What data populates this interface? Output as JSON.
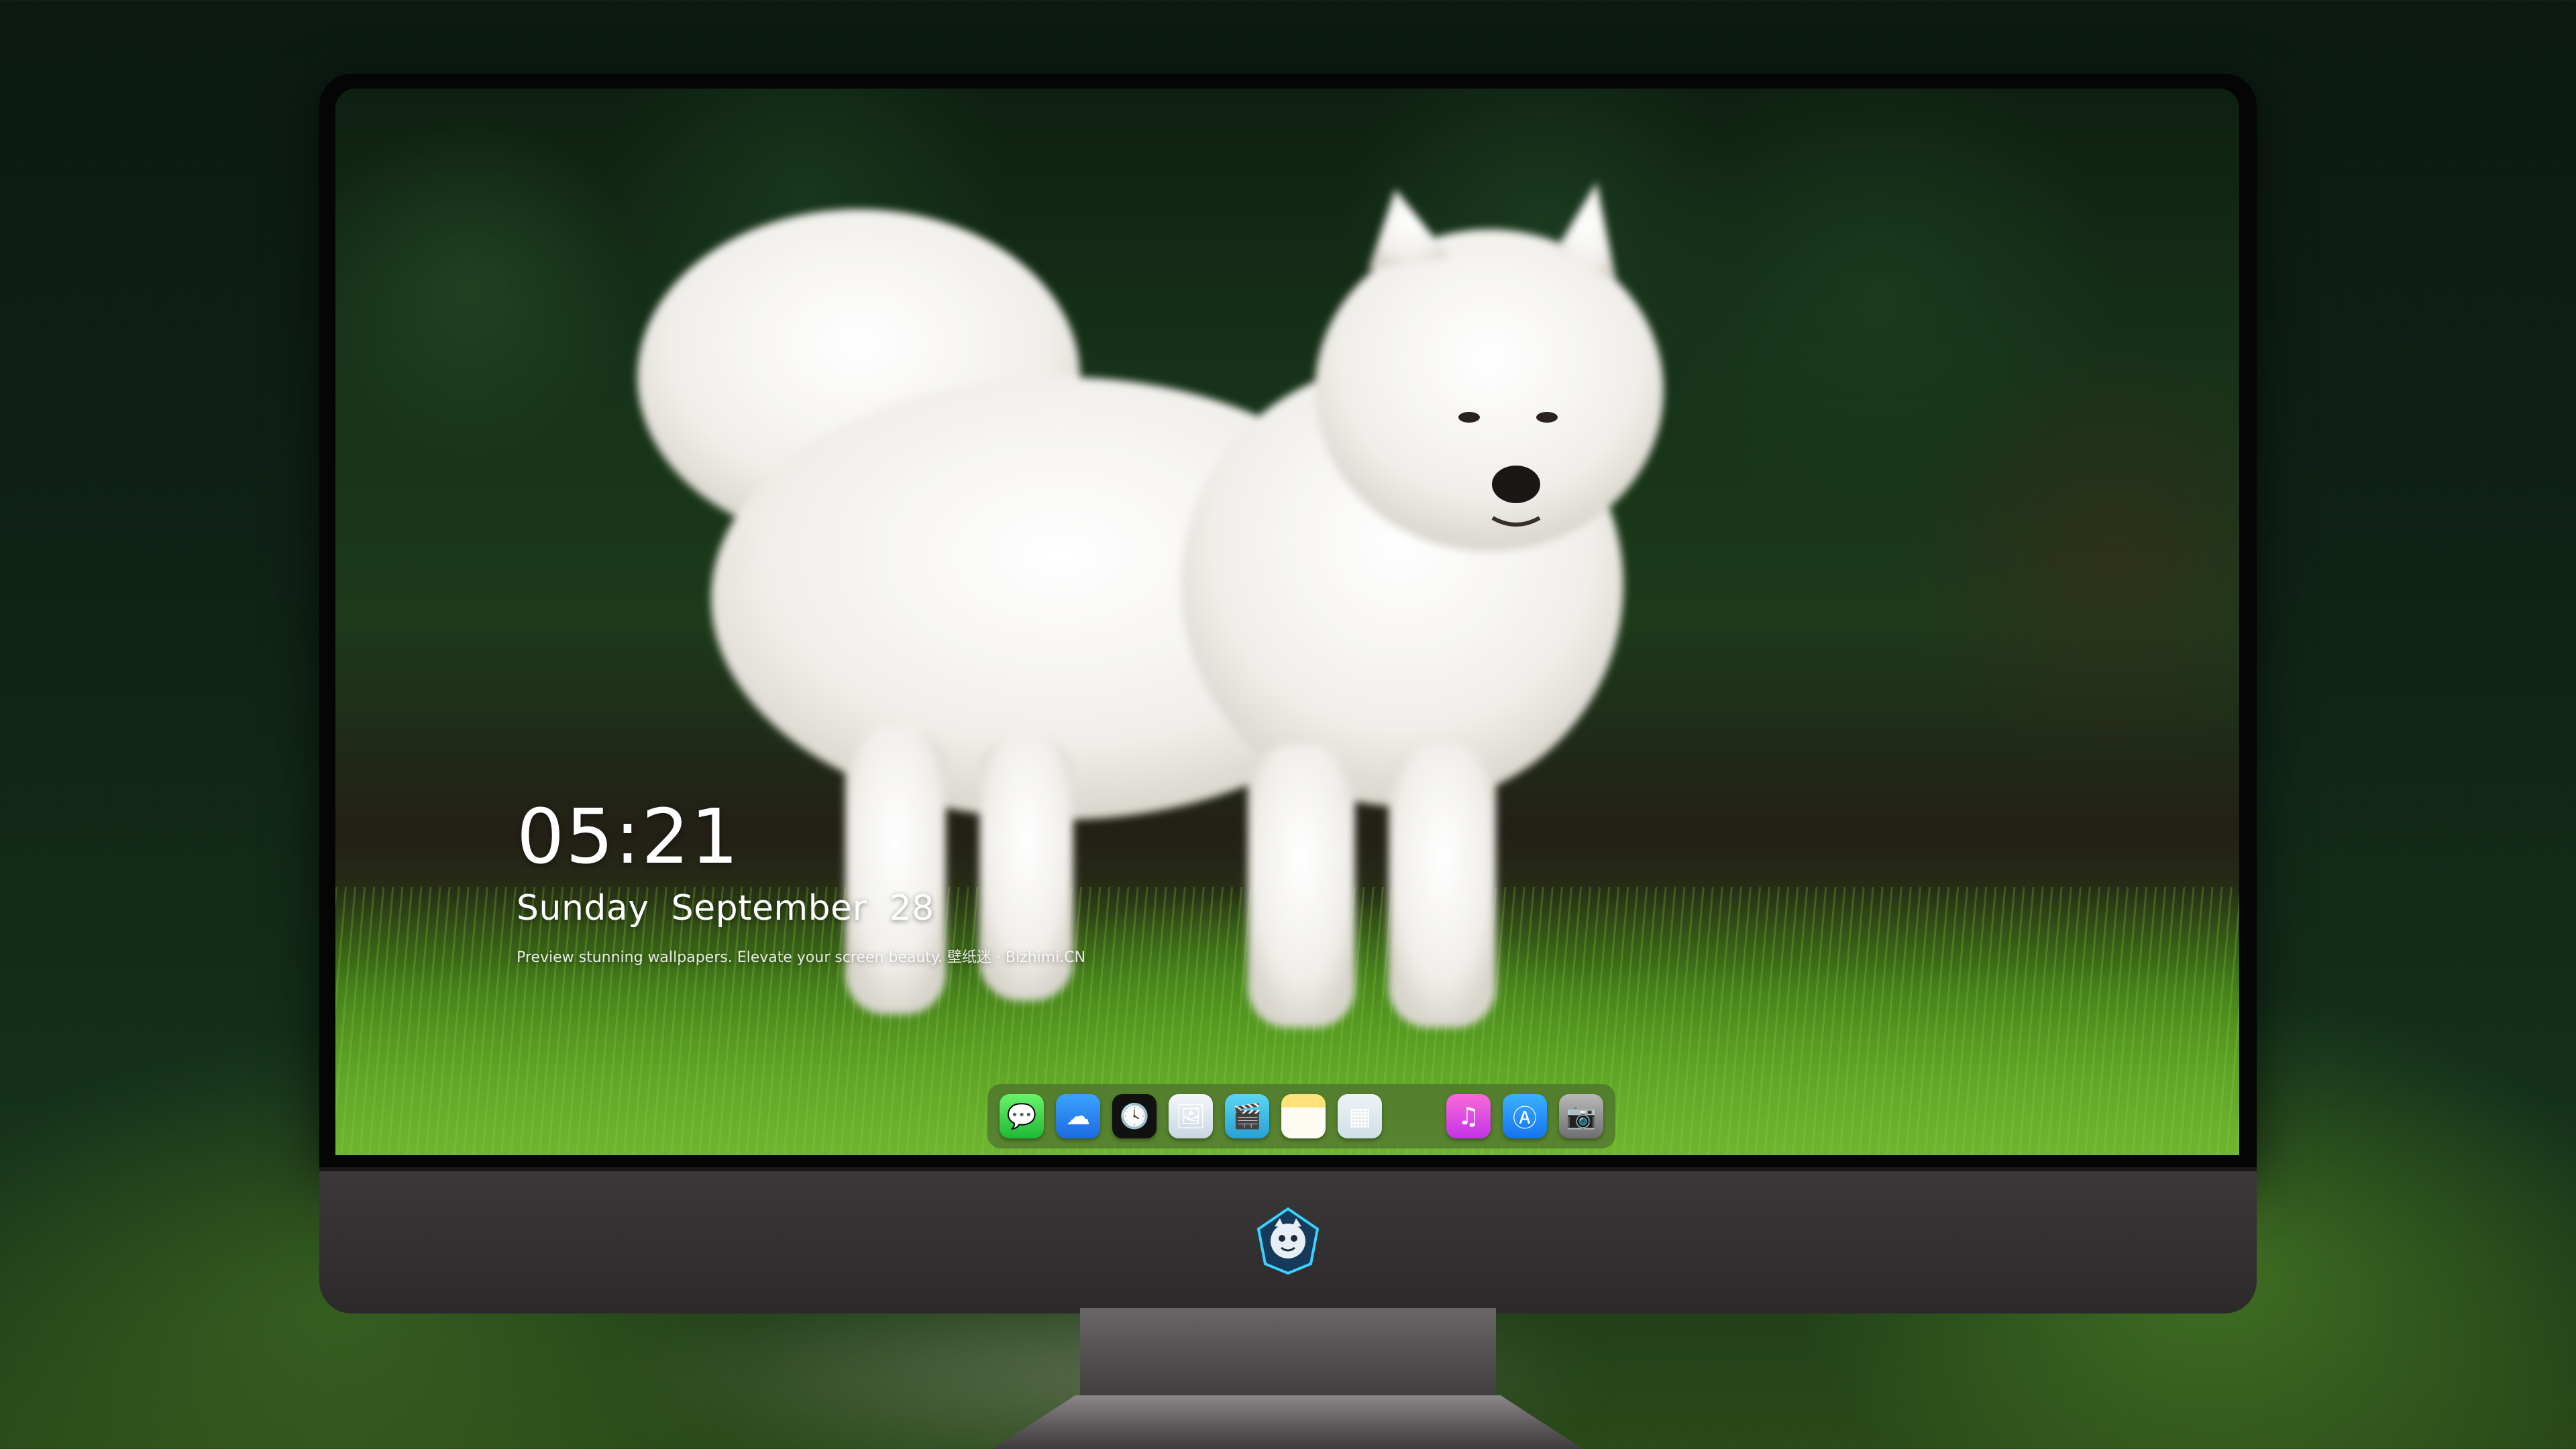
{
  "lockscreen": {
    "time": "05:21",
    "weekday": "Sunday",
    "month": "September",
    "day": "28",
    "caption": "Preview stunning wallpapers. Elevate your screen beauty. 壁纸迷 · Bizhimi.CN"
  },
  "dock": {
    "icons": [
      {
        "name": "messages-icon",
        "glyph": "💬"
      },
      {
        "name": "weather-icon",
        "glyph": "☁"
      },
      {
        "name": "clock-icon",
        "glyph": "🕓"
      },
      {
        "name": "preview-icon",
        "glyph": "🖼"
      },
      {
        "name": "final-cut-icon",
        "glyph": "🎬"
      },
      {
        "name": "notes-icon",
        "glyph": ""
      },
      {
        "name": "photos-icon",
        "glyph": "▦"
      },
      {
        "name": "music-icon",
        "glyph": "♫"
      },
      {
        "name": "app-store-icon",
        "glyph": "Ⓐ"
      },
      {
        "name": "camera-icon",
        "glyph": "📷"
      }
    ]
  },
  "colors": {
    "bezel": "#050505",
    "chin": "#3b3839",
    "text": "#ffffff"
  }
}
